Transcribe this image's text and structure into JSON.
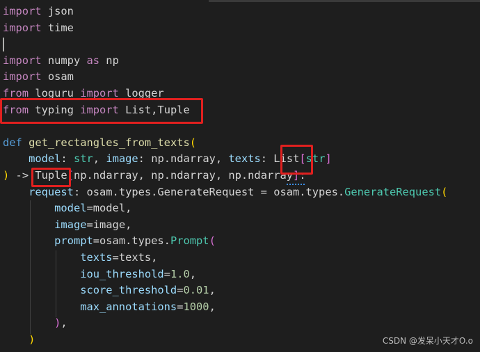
{
  "lines": [
    [
      [
        "kw",
        "import"
      ],
      [
        "pl",
        " json"
      ]
    ],
    [
      [
        "kw",
        "import"
      ],
      [
        "pl",
        " time"
      ]
    ],
    [],
    [
      [
        "kw",
        "import"
      ],
      [
        "pl",
        " numpy "
      ],
      [
        "kw",
        "as"
      ],
      [
        "pl",
        " np"
      ]
    ],
    [
      [
        "kw",
        "import"
      ],
      [
        "pl",
        " osam"
      ]
    ],
    [
      [
        "kw",
        "from"
      ],
      [
        "pl",
        " loguru "
      ],
      [
        "kw",
        "import"
      ],
      [
        "pl",
        " logger"
      ]
    ],
    [
      [
        "kw",
        "from"
      ],
      [
        "pl",
        " typing "
      ],
      [
        "kw",
        "import"
      ],
      [
        "pl",
        " List,Tuple"
      ]
    ],
    [],
    [
      [
        "def",
        "def"
      ],
      [
        "pl",
        " "
      ],
      [
        "fn",
        "get_rectangles_from_texts"
      ],
      [
        "br1",
        "("
      ]
    ],
    [
      [
        "pl",
        "    "
      ],
      [
        "var",
        "model"
      ],
      [
        "pl",
        ": "
      ],
      [
        "type",
        "str"
      ],
      [
        "pl",
        ", "
      ],
      [
        "var",
        "image"
      ],
      [
        "pl",
        ": np.ndarray, "
      ],
      [
        "var",
        "texts"
      ],
      [
        "pl",
        ": "
      ],
      [
        "pl",
        "List"
      ],
      [
        "br2",
        "["
      ],
      [
        "type",
        "str"
      ],
      [
        "br2",
        "]"
      ]
    ],
    [
      [
        "br1",
        ")"
      ],
      [
        "pl",
        " -> "
      ],
      [
        "pl",
        "Tuple"
      ],
      [
        "br2",
        "["
      ],
      [
        "pl",
        "np.ndarray, np.ndarray, np.ndarray"
      ],
      [
        "br2",
        "]"
      ],
      [
        "pl",
        ":"
      ]
    ],
    [
      [
        "pl",
        "    "
      ],
      [
        "var",
        "request"
      ],
      [
        "pl",
        ": osam.types.GenerateRequest = osam.types."
      ],
      [
        "type",
        "GenerateRequest"
      ],
      [
        "br1",
        "("
      ]
    ],
    [
      [
        "pl",
        "        "
      ],
      [
        "var",
        "model"
      ],
      [
        "pl",
        "=model,"
      ]
    ],
    [
      [
        "pl",
        "        "
      ],
      [
        "var",
        "image"
      ],
      [
        "pl",
        "=image,"
      ]
    ],
    [
      [
        "pl",
        "        "
      ],
      [
        "var",
        "prompt"
      ],
      [
        "pl",
        "=osam.types."
      ],
      [
        "type",
        "Prompt"
      ],
      [
        "br2",
        "("
      ]
    ],
    [
      [
        "pl",
        "            "
      ],
      [
        "var",
        "texts"
      ],
      [
        "pl",
        "=texts,"
      ]
    ],
    [
      [
        "pl",
        "            "
      ],
      [
        "var",
        "iou_threshold"
      ],
      [
        "pl",
        "="
      ],
      [
        "num",
        "1.0"
      ],
      [
        "pl",
        ","
      ]
    ],
    [
      [
        "pl",
        "            "
      ],
      [
        "var",
        "score_threshold"
      ],
      [
        "pl",
        "="
      ],
      [
        "num",
        "0.01"
      ],
      [
        "pl",
        ","
      ]
    ],
    [
      [
        "pl",
        "            "
      ],
      [
        "var",
        "max_annotations"
      ],
      [
        "pl",
        "="
      ],
      [
        "num",
        "1000"
      ],
      [
        "pl",
        ","
      ]
    ],
    [
      [
        "pl",
        "        "
      ],
      [
        "br2",
        ")"
      ],
      [
        "pl",
        ","
      ]
    ],
    [
      [
        "pl",
        "    "
      ],
      [
        "br1",
        ")"
      ]
    ]
  ],
  "watermark": "CSDN @发呆小天才O.o",
  "highlights": [
    "from-typing-line",
    "List-annotation",
    "Tuple-annotation"
  ]
}
